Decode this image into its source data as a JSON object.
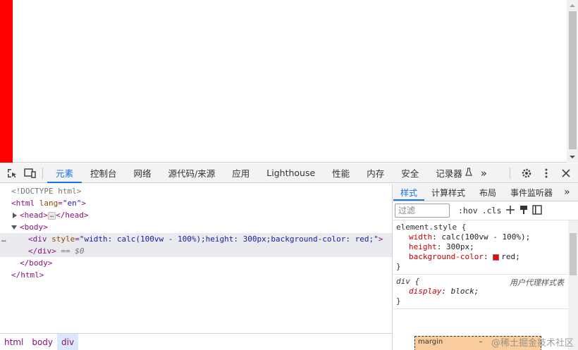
{
  "toolbar": {
    "tabs": [
      "元素",
      "控制台",
      "网络",
      "源代码/来源",
      "应用",
      "Lighthouse",
      "性能",
      "内存",
      "安全",
      "记录器"
    ],
    "more": "»"
  },
  "elements": {
    "lines": {
      "doctype": "<!DOCTYPE html>",
      "html_open_tag": "<html",
      "html_attr_name": "lang",
      "html_attr_value": "\"en\"",
      "html_open_close": ">",
      "head": "<head>",
      "head_close": "</head>",
      "body_open": "<body>",
      "div_open": "<div",
      "div_attr_name": "style",
      "div_attr_value": "\"width: calc(100vw - 100%);height: 300px;background-color: red;\"",
      "div_close_bracket": ">",
      "div_end": "</div>",
      "div_end_marker": "== $0",
      "body_close": "</body>",
      "html_close": "</html>",
      "ellipsis": "…",
      "row_dots": "…"
    },
    "breadcrumbs": [
      "html",
      "body",
      "div"
    ]
  },
  "styles": {
    "tabs": [
      "样式",
      "计算样式",
      "布局",
      "事件监听器"
    ],
    "more": "»",
    "filter_placeholder": "过滤",
    "hov": ":hov",
    "cls": ".cls",
    "element_style": {
      "selector": "element.style {",
      "props": [
        {
          "name": "width",
          "value": "calc(100vw - 100%);"
        },
        {
          "name": "height",
          "value": "300px;"
        },
        {
          "name": "background-color",
          "value": "red;"
        }
      ],
      "close": "}"
    },
    "ua_rule": {
      "selector": "div {",
      "note": "用户代理样式表",
      "prop_name": "display",
      "prop_value": "block;",
      "close": "}"
    },
    "box_model_label": "margin",
    "box_model_dash": "–"
  },
  "watermark": "@稀土掘金技术社区",
  "colors": {
    "preview_box": "#ff0000",
    "accent": "#1a73e8"
  }
}
